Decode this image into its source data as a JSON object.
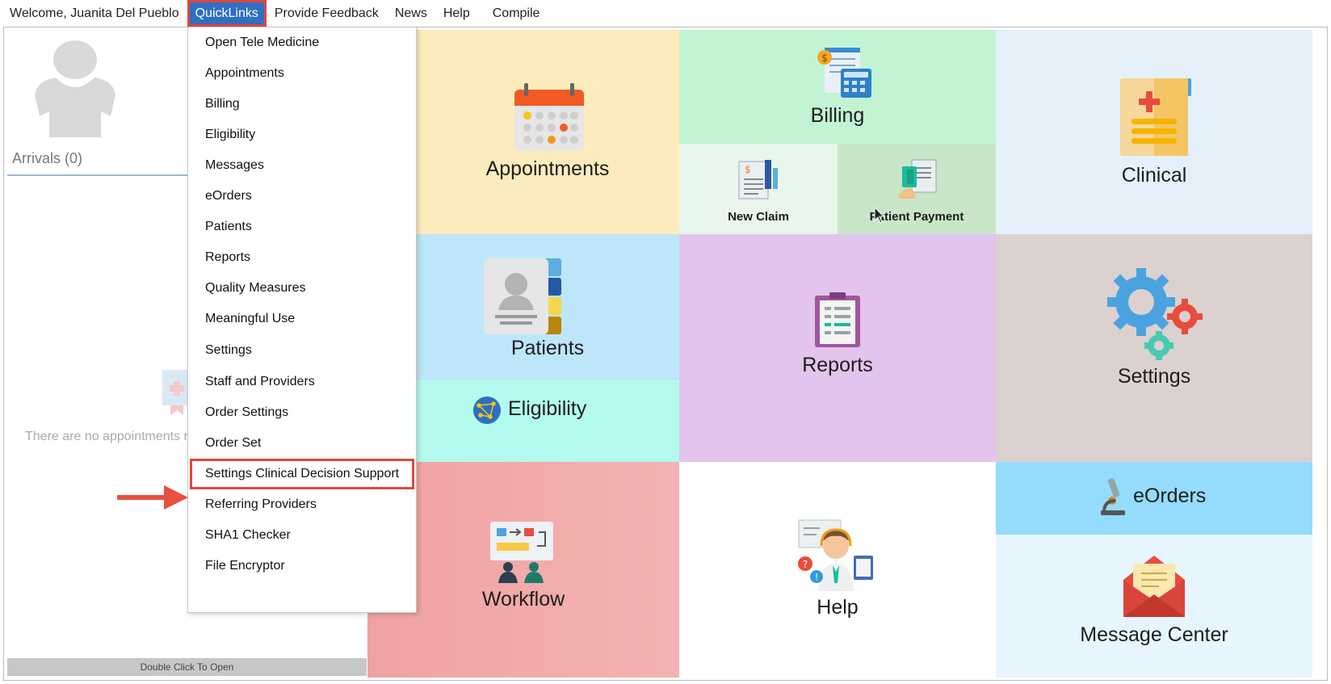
{
  "header": {
    "welcome": "Welcome, Juanita Del Pueblo",
    "menu": [
      {
        "label": "QuickLinks",
        "active": true
      },
      {
        "label": "Provide Feedback"
      },
      {
        "label": "News"
      },
      {
        "label": "Help"
      },
      {
        "label": "Compile"
      }
    ]
  },
  "left_panel": {
    "arrivals": "Arrivals (0)",
    "empty_message": "There are no appointments r",
    "footer": "Double Click To Open"
  },
  "quicklinks": [
    "Open Tele Medicine",
    "Appointments",
    "Billing",
    "Eligibility",
    "Messages",
    "eOrders",
    "Patients",
    "Reports",
    "Quality Measures",
    "Meaningful Use",
    "Settings",
    "Staff and Providers",
    "Order Settings",
    "Order Set",
    "Settings Clinical Decision Support",
    "Referring Providers",
    "SHA1 Checker",
    "File Encryptor"
  ],
  "tiles": {
    "appointments": "Appointments",
    "billing": "Billing",
    "new_claim": "New Claim",
    "patient_payment": "Patient Payment",
    "clinical": "Clinical",
    "patients": "Patients",
    "eligibility": "Eligibility",
    "reports": "Reports",
    "settings": "Settings",
    "workflow": "Workflow",
    "help": "Help",
    "eorders": "eOrders",
    "message_center": "Message Center"
  },
  "colors": {
    "menu_active": "#2f6fc2",
    "highlight_border": "#e0463c",
    "appointments_bg": "#fcecbd",
    "billing_bg": "#c2f4d4",
    "clinical_bg": "#e4f1fb",
    "patients_bg": "#bde6f9",
    "eligibility_bg": "#b3fbee",
    "reports_bg": "#e3c4ec",
    "settings_bg": "#dbd1cf",
    "workflow_bg": "#f0a2a1",
    "eorders_bg": "#94dbfc",
    "message_center_bg": "#e6f5fe"
  },
  "icons": [
    "user-avatar-icon",
    "calendar-icon",
    "billing-calculator-icon",
    "claim-document-icon",
    "payment-icon",
    "clinical-folder-icon",
    "contact-book-icon",
    "globe-network-icon",
    "clipboard-icon",
    "gears-icon",
    "workflow-board-icon",
    "support-agent-icon",
    "microscope-icon",
    "envelope-icon",
    "red-arrow-icon",
    "mouse-cursor-icon"
  ]
}
